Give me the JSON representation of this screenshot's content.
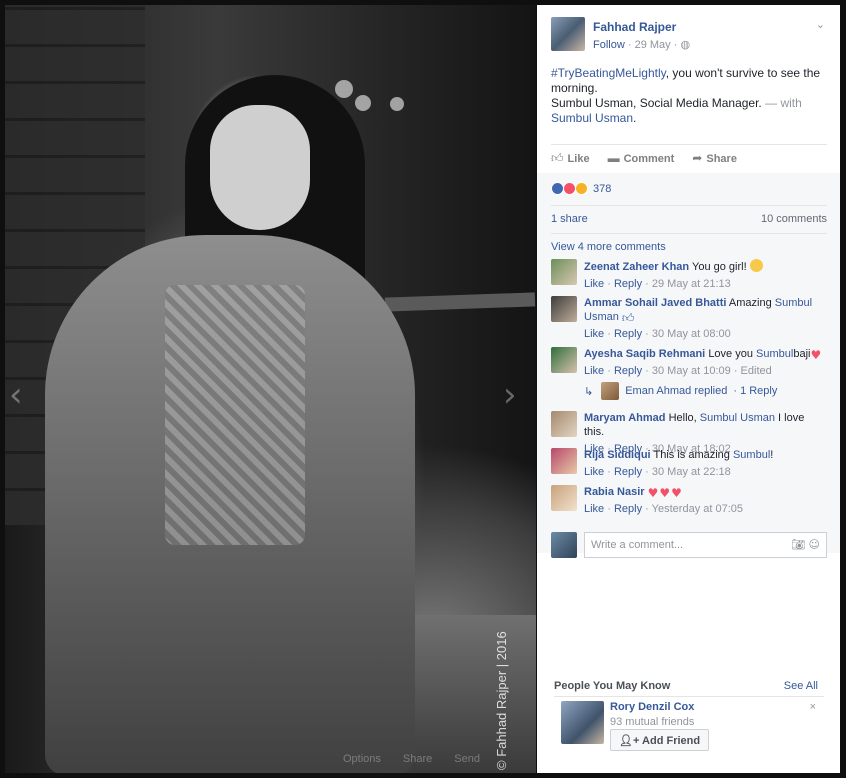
{
  "photo": {
    "watermark": "© Fahhad Rajper | 2016",
    "actions": [
      "Options",
      "Share",
      "Send"
    ]
  },
  "post": {
    "author": "Fahhad Rajper",
    "follow_label": "Follow",
    "date": "· 29 May ·",
    "hashtag": "#TryBeatingMeLightly",
    "text_1": ", you won't survive to see the morning.",
    "text_2": "Sumbul Usman, Social Media Manager.",
    "with_label": " — with",
    "tagged": "Sumbul Usman",
    "end_period": "."
  },
  "actions": {
    "like": "Like",
    "comment": "Comment",
    "share": "Share"
  },
  "stats": {
    "reaction_count": "378",
    "shares": "1 share",
    "comments": "10 comments"
  },
  "view_more": "View 4 more comments",
  "comments": [
    {
      "name": "Zeenat Zaheer Khan",
      "text": "You go girl!",
      "like": "Like",
      "reply": "Reply",
      "time": "29 May at 21:13",
      "extra": ""
    },
    {
      "name": "Ammar Sohail Javed Bhatti",
      "text": "Amazing",
      "link": "Sumbul Usman",
      "like": "Like",
      "reply": "Reply",
      "time": "30 May at 08:00",
      "extra": ""
    },
    {
      "name": "Ayesha Saqib Rehmani",
      "text": "Love you",
      "link": "Sumbul",
      "after": "baji",
      "like": "Like",
      "reply": "Reply",
      "time": "30 May at 10:09",
      "extra": "· Edited"
    },
    {
      "name": "Maryam Ahmad",
      "text": "Hello,",
      "link": "Sumbul Usman",
      "after": "I love this.",
      "like": "Like",
      "reply": "Reply",
      "time": "30 May at 18:02",
      "extra": ""
    },
    {
      "name": "Rija Siddiqui",
      "text": "This is amazing",
      "link": "Sumbul",
      "after": "!",
      "like": "Like",
      "reply": "Reply",
      "time": "30 May at 22:18",
      "extra": ""
    },
    {
      "name": "Rabia Nasir",
      "text": "",
      "like": "Like",
      "reply": "Reply",
      "time": "Yesterday at 07:05",
      "extra": ""
    }
  ],
  "reply_line": {
    "name": "Eman Ahmad replied",
    "count": "· 1 Reply"
  },
  "write_placeholder": "Write a comment...",
  "pymk": {
    "title": "People You May Know",
    "see_all": "See All",
    "name": "Rory Denzil Cox",
    "mutual": "93 mutual friends",
    "add": "Add Friend",
    "close": "×"
  },
  "icons": {
    "left_arrow": "chevron-left-icon",
    "right_arrow": "chevron-right-icon",
    "like": "thumbs-up-icon",
    "comment": "comment-icon",
    "share": "share-arrow-icon",
    "globe": "globe-icon",
    "camera": "camera-icon",
    "emoji": "smiley-icon"
  },
  "colors": {
    "link": "#365899",
    "panel_bg": "#ffffff",
    "gray_bg": "#f6f7f9",
    "muted": "#90949c"
  }
}
